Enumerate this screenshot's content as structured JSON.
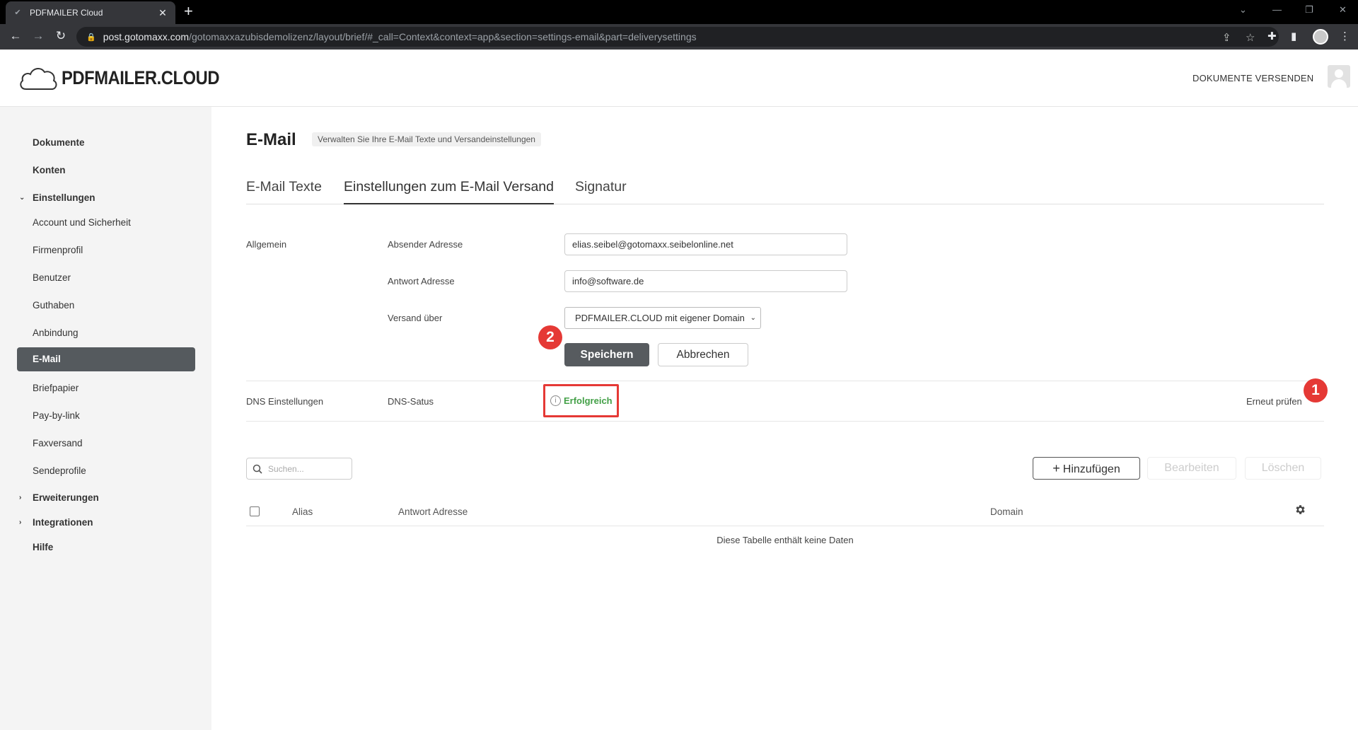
{
  "browser": {
    "tab_title": "PDFMAILER Cloud",
    "url_host": "post.gotomaxx.com",
    "url_path": "/gotomaxxazubisdemolizenz/layout/brief/#_call=Context&context=app&section=settings-email&part=deliverysettings"
  },
  "header": {
    "logo_text": "PDFMAILER.CLOUD",
    "send_documents": "DOKUMENTE VERSENDEN"
  },
  "sidebar": {
    "items": [
      {
        "label": "Dokumente"
      },
      {
        "label": "Konten"
      },
      {
        "label": "Einstellungen"
      },
      {
        "label": "Account und Sicherheit"
      },
      {
        "label": "Firmenprofil"
      },
      {
        "label": "Benutzer"
      },
      {
        "label": "Guthaben"
      },
      {
        "label": "Anbindung"
      },
      {
        "label": "E-Mail"
      },
      {
        "label": "Briefpapier"
      },
      {
        "label": "Pay-by-link"
      },
      {
        "label": "Faxversand"
      },
      {
        "label": "Sendeprofile"
      },
      {
        "label": "Erweiterungen"
      },
      {
        "label": "Integrationen"
      },
      {
        "label": "Hilfe"
      }
    ]
  },
  "page": {
    "title": "E-Mail",
    "subtitle": "Verwalten Sie Ihre E-Mail Texte und Versandeinstellungen",
    "tabs": [
      {
        "label": "E-Mail Texte"
      },
      {
        "label": "Einstellungen zum E-Mail Versand"
      },
      {
        "label": "Signatur"
      }
    ]
  },
  "general": {
    "section_label": "Allgemein",
    "sender_label": "Absender Adresse",
    "sender_value": "elias.seibel@gotomaxx.seibelonline.net",
    "reply_label": "Antwort Adresse",
    "reply_value": "info@software.de",
    "via_label": "Versand über",
    "via_value": "PDFMAILER.CLOUD mit eigener Domain",
    "save_label": "Speichern",
    "cancel_label": "Abbrechen"
  },
  "dns": {
    "section_label": "DNS Einstellungen",
    "status_label": "DNS-Satus",
    "status_value": "Erfolgreich",
    "recheck_label": "Erneut prüfen"
  },
  "annotations": {
    "badge1": "1",
    "badge2": "2"
  },
  "table": {
    "search_placeholder": "Suchen...",
    "add_label": "Hinzufügen",
    "edit_label": "Bearbeiten",
    "delete_label": "Löschen",
    "columns": [
      "Alias",
      "Antwort Adresse",
      "Domain"
    ],
    "empty_message": "Diese Tabelle enthält keine Daten"
  },
  "colors": {
    "accent": "#575b5f",
    "success": "#43a047",
    "annotation": "#e53935"
  }
}
